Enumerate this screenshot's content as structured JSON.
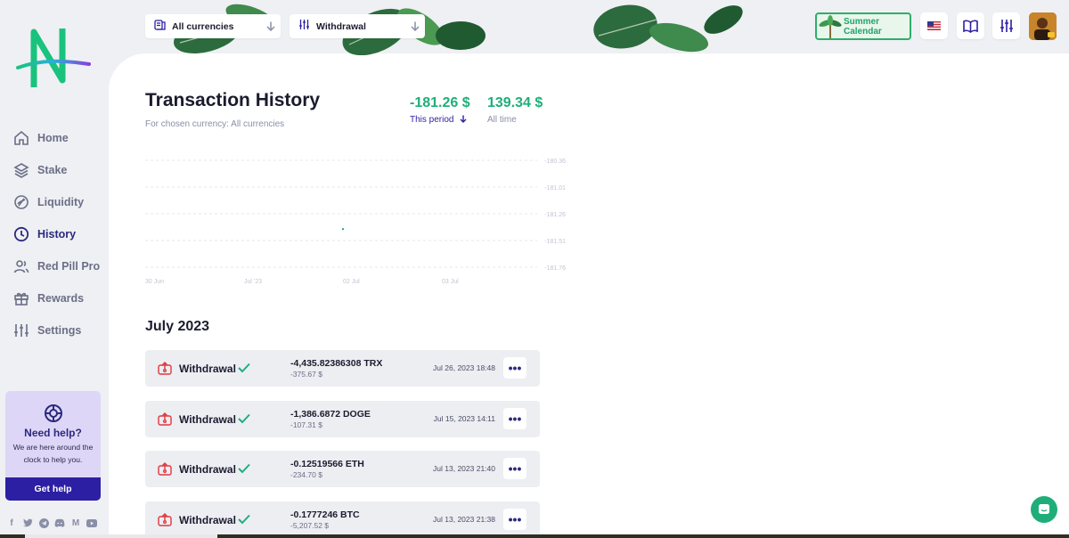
{
  "sidebar": {
    "items": [
      {
        "label": "Home",
        "icon": "home-icon"
      },
      {
        "label": "Stake",
        "icon": "layers-icon"
      },
      {
        "label": "Liquidity",
        "icon": "liquidity-icon"
      },
      {
        "label": "History",
        "icon": "clock-icon",
        "active": true
      },
      {
        "label": "Red Pill Pro",
        "icon": "users-icon"
      },
      {
        "label": "Rewards",
        "icon": "gift-icon"
      },
      {
        "label": "Settings",
        "icon": "sliders-icon"
      }
    ],
    "help": {
      "title": "Need help?",
      "text": "We are here around the clock to help you.",
      "button": "Get help"
    },
    "socials": [
      "facebook-icon",
      "twitter-icon",
      "telegram-icon",
      "discord-icon",
      "medium-icon",
      "youtube-icon"
    ]
  },
  "topbar": {
    "currency_filter": "All currencies",
    "type_filter": "Withdrawal",
    "promo": "Summer Calendar"
  },
  "header": {
    "title": "Transaction History",
    "subtitle": "For chosen currency: All currencies",
    "period_value": "-181.26 $",
    "period_label": "This period",
    "alltime_value": "139.34 $",
    "alltime_label": "All time"
  },
  "chart_data": {
    "type": "line",
    "x_ticks": [
      "30 Jun",
      "Jul '23",
      "02 Jul",
      "03 Jul"
    ],
    "y_ticks": [
      "-180.36",
      "-181.01",
      "-181.26",
      "-181.51",
      "-181.76"
    ],
    "series": [
      {
        "values": [
          -181.26
        ]
      }
    ],
    "grid": true
  },
  "month_label": "July 2023",
  "transactions": [
    {
      "type": "Withdrawal",
      "amount": "-4,435.82386308 TRX",
      "usd": "-375.67 $",
      "date": "Jul 26, 2023 18:48"
    },
    {
      "type": "Withdrawal",
      "amount": "-1,386.6872 DOGE",
      "usd": "-107.31 $",
      "date": "Jul 15, 2023 14:11"
    },
    {
      "type": "Withdrawal",
      "amount": "-0.12519566 ETH",
      "usd": "-234.70 $",
      "date": "Jul 13, 2023 21:40"
    },
    {
      "type": "Withdrawal",
      "amount": "-0.1777246 BTC",
      "usd": "-5,207.52 $",
      "date": "Jul 13, 2023 21:38"
    }
  ],
  "colors": {
    "accent": "#2d1fa3",
    "positive": "#1fae7a",
    "danger": "#e0383e"
  }
}
